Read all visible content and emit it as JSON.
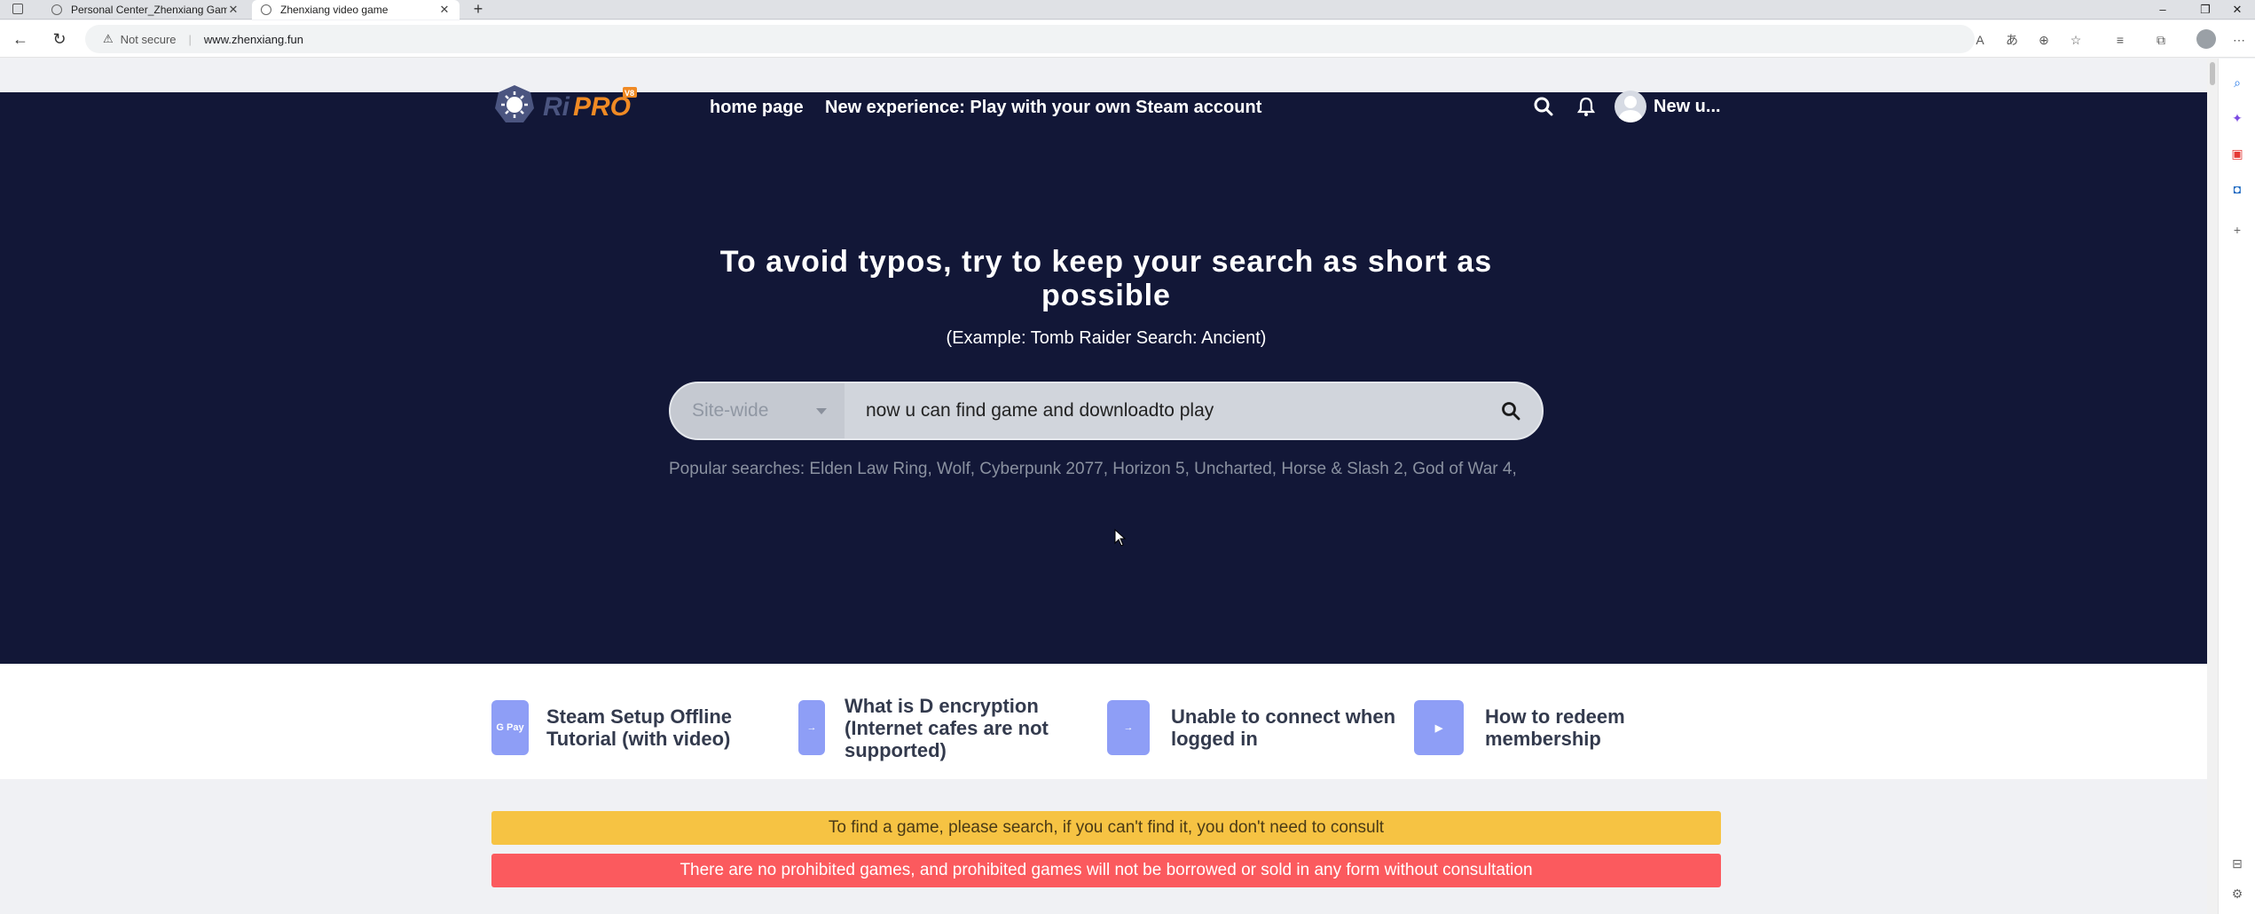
{
  "browser": {
    "tabs": [
      {
        "title": "Personal Center_Zhenxiang Gam",
        "active": false
      },
      {
        "title": "Zhenxiang video game",
        "active": true
      }
    ],
    "security_label": "Not secure",
    "url": "www.zhenxiang.fun",
    "icons": [
      "back-icon",
      "refresh-icon",
      "read-aloud-icon",
      "translate-icon",
      "zoom-icon",
      "favorite-icon",
      "favorites-icon",
      "collections-icon",
      "profile-icon",
      "more-icon"
    ]
  },
  "site": {
    "nav": {
      "home_label": "home page",
      "steam_label": "New experience: Play with your own Steam account",
      "user_name": "New u..."
    },
    "hero": {
      "title": "To avoid typos, try to keep your search as short as possible",
      "subtitle": "(Example: Tomb Raider Search: Ancient)"
    },
    "search": {
      "scope": "Site-wide",
      "query": "now u can find game and downloadto play"
    },
    "popular": "Popular searches: Elden Law Ring, Wolf, Cyberpunk 2077, Horizon 5, Uncharted, Horse & Slash 2, God of War 4,",
    "quick_links": [
      {
        "label": "Steam Setup Offline Tutorial (with video)",
        "icon_text": "G Pay"
      },
      {
        "label": "What is D encryption (Internet cafes are not supported)",
        "icon_text": "→"
      },
      {
        "label": "Unable to connect when logged in",
        "icon_text": "→"
      },
      {
        "label": "How to redeem membership",
        "icon_text": "▶"
      }
    ],
    "notices": {
      "yellow": "To find a game, please search, if you can't find it, you don't need to consult",
      "red": "There are no prohibited games, and prohibited games will not be borrowed or sold in any form without consultation"
    }
  },
  "colors": {
    "hero_bg": "#121737",
    "accent_blue": "#8e9ef6",
    "notice_yellow": "#f6c343",
    "notice_red": "#fb5a5e",
    "logo_orange": "#f08a24"
  }
}
